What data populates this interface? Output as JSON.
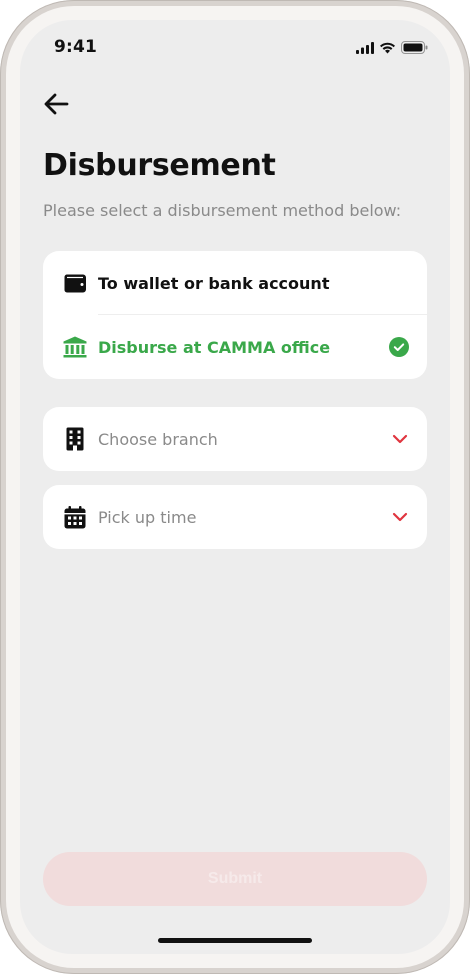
{
  "status_bar": {
    "time": "9:41",
    "icons": [
      "signal-icon",
      "wifi-icon",
      "battery-icon"
    ]
  },
  "header": {
    "back_icon": "arrow-left-icon",
    "title": "Disbursement",
    "subtitle": "Please select a disbursement method below:"
  },
  "methods": [
    {
      "label": "To wallet or bank account",
      "icon": "wallet-icon",
      "selected": false
    },
    {
      "label": "Disburse at CAMMA office",
      "icon": "bank-building-icon",
      "selected": true
    }
  ],
  "branch_select": {
    "placeholder": "Choose branch",
    "icon": "office-building-icon"
  },
  "time_select": {
    "placeholder": "Pick up time",
    "icon": "calendar-icon"
  },
  "submit": {
    "label": "Submit",
    "enabled": false
  },
  "colors": {
    "accent_green": "#3aa84a",
    "accent_red": "#e0353f",
    "disabled_button": "#f1dcdc",
    "background": "#ededed"
  }
}
